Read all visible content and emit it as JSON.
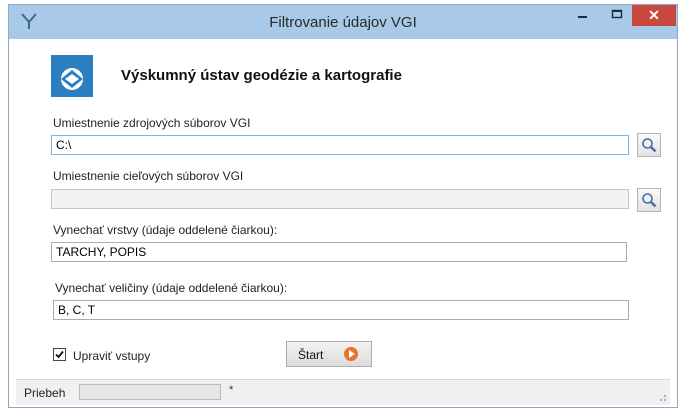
{
  "window": {
    "title": "Filtrovanie  údajov VGI",
    "minimize_icon": "minimize-icon",
    "maximize_icon": "maximize-icon",
    "close_icon": "close-icon",
    "close_glyph": "✕"
  },
  "header": {
    "organization": "Výskumný ústav geodézie a kartografie",
    "logo_icon": "vugk-logo-icon"
  },
  "source": {
    "label": "Umiestnenie zdrojových súborov VGI",
    "value": "C:\\",
    "browse_icon": "search-icon"
  },
  "target": {
    "label": "Umiestnenie cieľových súborov VGI",
    "value": "",
    "browse_icon": "search-icon"
  },
  "skip_layers": {
    "label": "Vynechať vrstvy (údaje oddelené čiarkou):",
    "value": "TARCHY, POPIS"
  },
  "skip_quantities": {
    "label": "Vynechať veličiny  (údaje oddelené čiarkou):",
    "value": "B, C, T"
  },
  "adjust_inputs": {
    "label": "Upraviť vstupy",
    "checked": true
  },
  "start_button": {
    "label": "Štart",
    "icon": "play-icon"
  },
  "status_bar": {
    "label": "Priebeh",
    "progress": 0,
    "marker": "*"
  },
  "colors": {
    "titlebar": "#a8c9e8",
    "close": "#c9483e",
    "logo": "#2a7fc1",
    "start_icon": "#e8742c"
  }
}
